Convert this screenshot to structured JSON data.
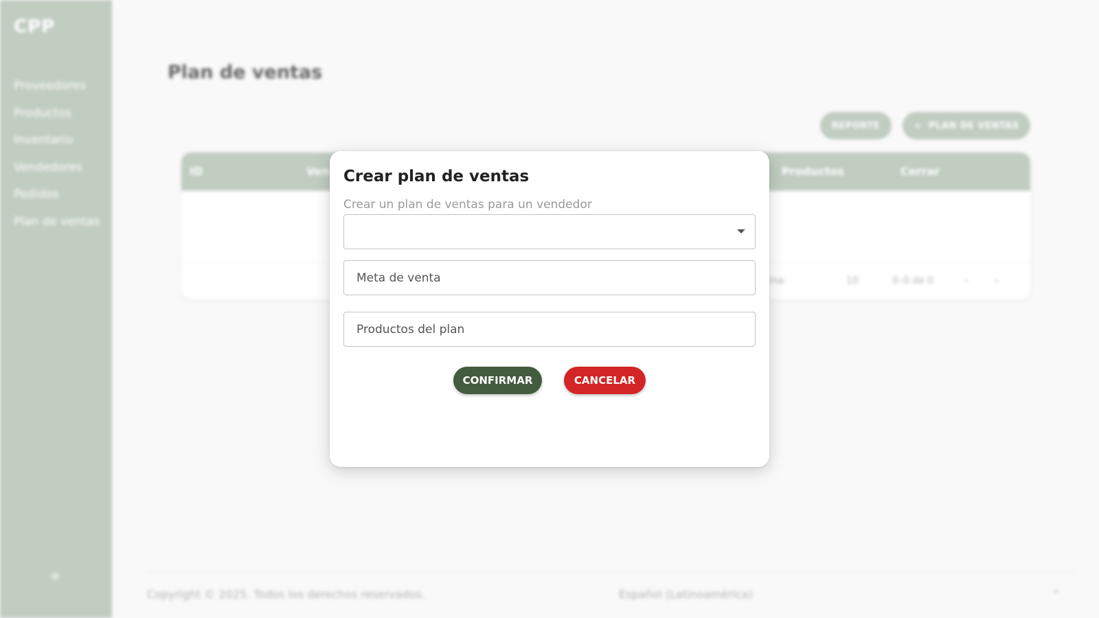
{
  "sidebar": {
    "logo": "CPP",
    "items": [
      {
        "label": "Proveedores"
      },
      {
        "label": "Productos"
      },
      {
        "label": "Inventario"
      },
      {
        "label": "Vendedores"
      },
      {
        "label": "Pedidos"
      },
      {
        "label": "Plan de ventas"
      }
    ],
    "bottom_icon": "settings-icon"
  },
  "main": {
    "title": "Plan de ventas",
    "report_button": "REPORTE",
    "add_button": "PLAN DE VENTAS",
    "add_icon": "+"
  },
  "table": {
    "columns": [
      "ID",
      "Ven",
      "Productos",
      "Cerrar"
    ],
    "pagination": {
      "rows_per_page_label": "Filas por página:",
      "rows_per_page": "10",
      "range": "0–0 de 0",
      "prev": "‹",
      "next": "›"
    }
  },
  "footer": {
    "copyright": "Copyright © 2025. Todos los derechos reservados.",
    "language": "Español (Latinoamérica)",
    "language_caret": "⌃"
  },
  "dialog": {
    "title": "Crear plan de ventas",
    "subtitle": "Crear un plan de ventas para un vendedor",
    "vendor_select_value": "",
    "goal_placeholder": "Meta de venta",
    "products_placeholder": "Productos del plan",
    "confirm_label": "CONFIRMAR",
    "cancel_label": "CANCELAR"
  },
  "colors": {
    "sidebar": "#adbcad",
    "confirm": "#435b3f",
    "cancel": "#d32525"
  }
}
